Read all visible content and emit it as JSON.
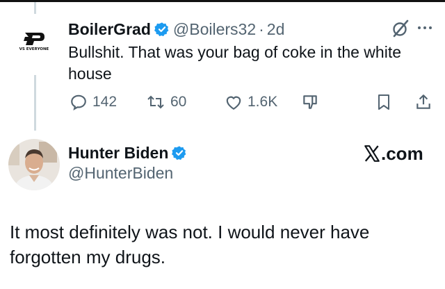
{
  "reply_tweet": {
    "author_name": "BoilerGrad",
    "handle": "@Boilers32",
    "separator": "·",
    "time_ago": "2d",
    "avatar_caption": "VS EVERYONE",
    "text": "Bullshit. That was your bag of coke in the white house",
    "actions": {
      "replies": "142",
      "reposts": "60",
      "likes": "1.6K"
    }
  },
  "quoted_tweet": {
    "author_name": "Hunter Biden",
    "handle": "@HunterBiden",
    "source_label": ".com",
    "text": "It most definitely was not. I would never have forgotten my drugs."
  },
  "colors": {
    "verified_blue": "#1d9bf0",
    "text_primary": "#0f1419",
    "text_secondary": "#536471",
    "thread_line": "#cfd9de"
  }
}
